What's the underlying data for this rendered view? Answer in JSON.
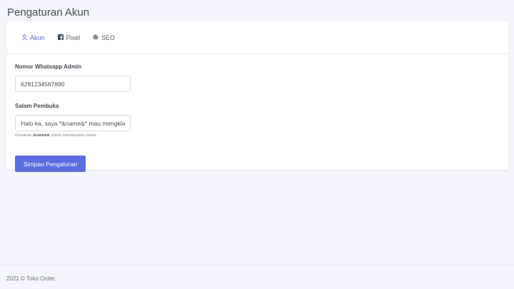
{
  "page": {
    "title": "Pengaturan Akun"
  },
  "tabs": [
    {
      "label": "Akun",
      "icon": "user-icon",
      "active": true
    },
    {
      "label": "Pixel",
      "icon": "facebook-icon",
      "active": false
    },
    {
      "label": "SEO",
      "icon": "globe-icon",
      "active": false
    }
  ],
  "form": {
    "whatsapp_label": "Nomor Whatsapp Admin",
    "whatsapp_value": "6281234567890",
    "greeting_label": "Salam Pembuka",
    "greeting_value": "Halo ka, saya *&name&* mau mengklaim",
    "hint_prefix": "Gunakan",
    "hint_code": "&name&",
    "hint_suffix": "untuk memasukan nama",
    "submit_label": "Simpan Pengaturan"
  },
  "footer": {
    "text": "2021 © Toko Order."
  },
  "colors": {
    "accent": "#5a6ee0",
    "active_tab": "#5a67d8",
    "background": "#f4f5f8"
  }
}
